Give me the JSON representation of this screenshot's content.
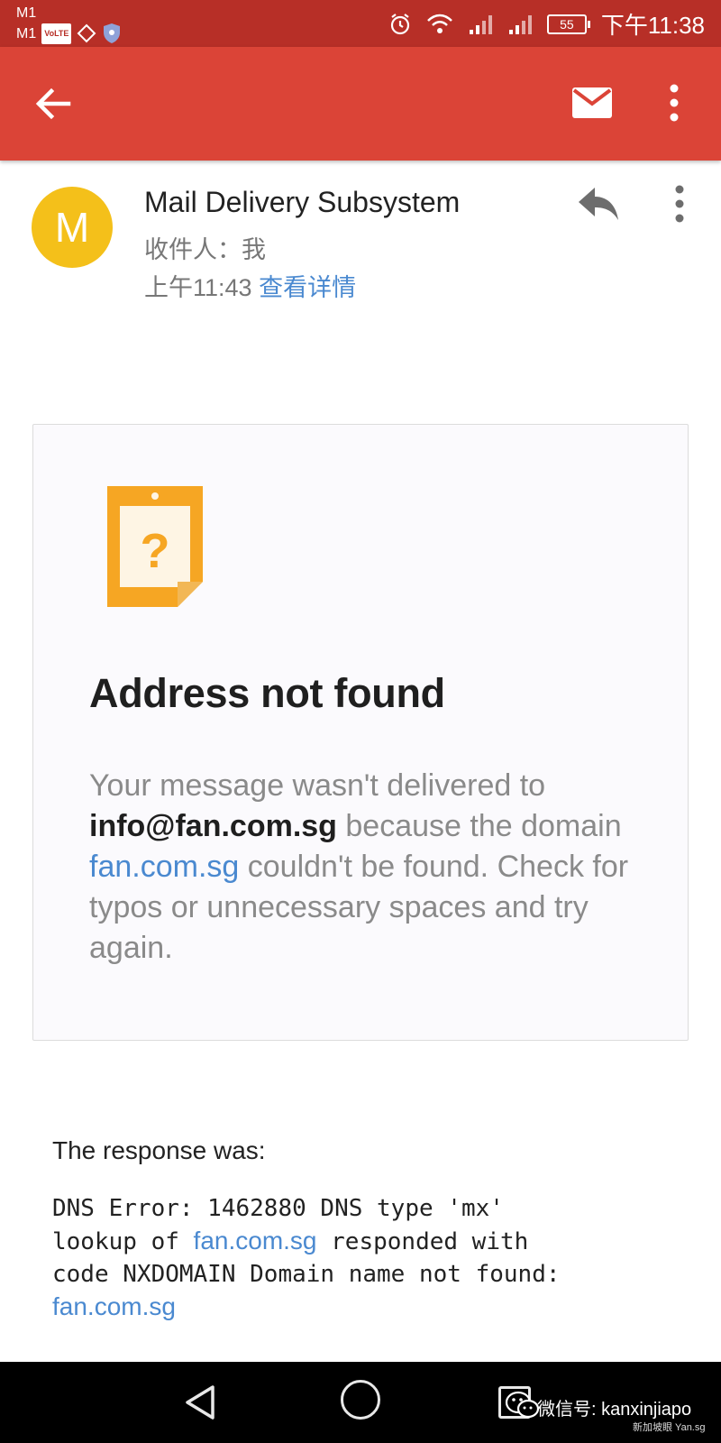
{
  "status_bar": {
    "carrier1": "M1",
    "carrier2": "M1",
    "volte": "VoLTE",
    "battery": "55",
    "time": "下午11:38"
  },
  "email": {
    "sender_initial": "M",
    "sender_name": "Mail Delivery Subsystem",
    "recipient": "收件人：我",
    "time": "上午11:43",
    "details_link": "查看详情"
  },
  "card": {
    "title": "Address not found",
    "msg_part1": "Your message wasn't delivered to ",
    "recipient_email": "info@fan.com.sg",
    "msg_part2": " because the domain ",
    "domain_link": "fan.com.sg",
    "msg_part3": " couldn't be found. Check for typos or unnecessary spaces and try again."
  },
  "response": {
    "label": "The response was:",
    "dns_part1": "DNS Error: 1462880 DNS type 'mx'\nlookup of ",
    "domain_link1": "fan.com.sg",
    "dns_part2": " responded with\ncode NXDOMAIN Domain name not found:\n",
    "domain_link2": "fan.com.sg"
  },
  "watermark": {
    "line1": "微信号: kanxinjiapo",
    "line2": "新加坡眼 Yan.sg"
  },
  "colors": {
    "app_bar": "#db4437",
    "status_bar": "#b72f27",
    "avatar": "#f4c01a",
    "link": "#4a89d0",
    "icon_orange": "#f6a623"
  },
  "icons": {
    "back": "arrow-back-icon",
    "mail": "mail-icon",
    "more": "more-vert-icon",
    "reply": "reply-icon",
    "card": "unknown-device-icon"
  }
}
